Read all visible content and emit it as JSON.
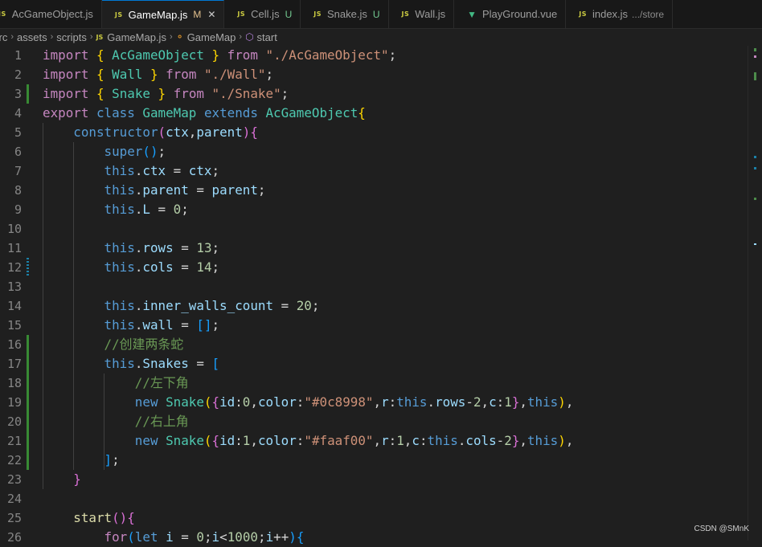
{
  "tabs": [
    {
      "label": "AcGameObject.js",
      "type": "js",
      "active": false,
      "badge": "",
      "hint": ""
    },
    {
      "label": "GameMap.js",
      "type": "js",
      "active": true,
      "badge": "M",
      "hint": ""
    },
    {
      "label": "Cell.js",
      "type": "js",
      "active": false,
      "badge": "U",
      "hint": ""
    },
    {
      "label": "Snake.js",
      "type": "js",
      "active": false,
      "badge": "U",
      "hint": ""
    },
    {
      "label": "Wall.js",
      "type": "js",
      "active": false,
      "badge": "",
      "hint": ""
    },
    {
      "label": "PlayGround.vue",
      "type": "vue",
      "active": false,
      "badge": "",
      "hint": ""
    },
    {
      "label": "index.js",
      "type": "js",
      "active": false,
      "badge": "",
      "hint": ".../store"
    }
  ],
  "js_icon": "JS",
  "close_glyph": "✕",
  "breadcrumb": [
    "src",
    "assets",
    "scripts",
    "GameMap.js",
    "GameMap",
    "start"
  ],
  "watermark": "CSDN @SMnK",
  "colors": {
    "keyword": "#c586c0",
    "storage": "#569cd6",
    "class": "#4ec9b0",
    "string": "#ce9178",
    "number": "#b5cea8",
    "comment": "#6a9955",
    "variable": "#9cdcfe",
    "function": "#dcdcaa",
    "bracket1": "#ffd700",
    "bracket2": "#da70d6",
    "bracket3": "#179fff",
    "default": "#d4d4d4",
    "added": "#388a34",
    "modified": "#1b81a8"
  },
  "lines": [
    {
      "n": "1",
      "t": [
        [
          "import ",
          "k"
        ],
        [
          "{",
          "b1"
        ],
        [
          " AcGameObject ",
          "c"
        ],
        [
          "}",
          "b1"
        ],
        [
          " from ",
          "k"
        ],
        [
          "\"./AcGameObject\"",
          "s"
        ],
        [
          ";",
          "d"
        ]
      ]
    },
    {
      "n": "2",
      "t": [
        [
          "import ",
          "k"
        ],
        [
          "{",
          "b1"
        ],
        [
          " Wall ",
          "c"
        ],
        [
          "}",
          "b1"
        ],
        [
          " from ",
          "k"
        ],
        [
          "\"./Wall\"",
          "s"
        ],
        [
          ";",
          "d"
        ]
      ]
    },
    {
      "n": "3",
      "t": [
        [
          "import ",
          "k"
        ],
        [
          "{",
          "b1"
        ],
        [
          " Snake ",
          "c"
        ],
        [
          "}",
          "b1"
        ],
        [
          " from ",
          "k"
        ],
        [
          "\"./Snake\"",
          "s"
        ],
        [
          ";",
          "d"
        ]
      ]
    },
    {
      "n": "4",
      "t": [
        [
          "export ",
          "k"
        ],
        [
          "class ",
          "st"
        ],
        [
          "GameMap ",
          "c"
        ],
        [
          "extends ",
          "st"
        ],
        [
          "AcGameObject",
          "c"
        ],
        [
          "{",
          "b1"
        ]
      ]
    },
    {
      "n": "5",
      "t": [
        [
          "    constructor",
          "st"
        ],
        [
          "(",
          "b2"
        ],
        [
          "ctx",
          "v"
        ],
        [
          ",",
          "d"
        ],
        [
          "parent",
          "v"
        ],
        [
          ")",
          "b2"
        ],
        [
          "{",
          "b2"
        ]
      ]
    },
    {
      "n": "6",
      "t": [
        [
          "        super",
          "st"
        ],
        [
          "()",
          "b3"
        ],
        [
          ";",
          "d"
        ]
      ]
    },
    {
      "n": "7",
      "t": [
        [
          "        this",
          "st"
        ],
        [
          ".",
          "d"
        ],
        [
          "ctx",
          "v"
        ],
        [
          " = ",
          "d"
        ],
        [
          "ctx",
          "v"
        ],
        [
          ";",
          "d"
        ]
      ]
    },
    {
      "n": "8",
      "t": [
        [
          "        this",
          "st"
        ],
        [
          ".",
          "d"
        ],
        [
          "parent",
          "v"
        ],
        [
          " = ",
          "d"
        ],
        [
          "parent",
          "v"
        ],
        [
          ";",
          "d"
        ]
      ]
    },
    {
      "n": "9",
      "t": [
        [
          "        this",
          "st"
        ],
        [
          ".",
          "d"
        ],
        [
          "L",
          "v"
        ],
        [
          " = ",
          "d"
        ],
        [
          "0",
          "n"
        ],
        [
          ";",
          "d"
        ]
      ]
    },
    {
      "n": "10",
      "t": []
    },
    {
      "n": "11",
      "t": [
        [
          "        this",
          "st"
        ],
        [
          ".",
          "d"
        ],
        [
          "rows",
          "v"
        ],
        [
          " = ",
          "d"
        ],
        [
          "13",
          "n"
        ],
        [
          ";",
          "d"
        ]
      ]
    },
    {
      "n": "12",
      "t": [
        [
          "        this",
          "st"
        ],
        [
          ".",
          "d"
        ],
        [
          "cols",
          "v"
        ],
        [
          " = ",
          "d"
        ],
        [
          "14",
          "n"
        ],
        [
          ";",
          "d"
        ]
      ]
    },
    {
      "n": "13",
      "t": []
    },
    {
      "n": "14",
      "t": [
        [
          "        this",
          "st"
        ],
        [
          ".",
          "d"
        ],
        [
          "inner_walls_count",
          "v"
        ],
        [
          " = ",
          "d"
        ],
        [
          "20",
          "n"
        ],
        [
          ";",
          "d"
        ]
      ]
    },
    {
      "n": "15",
      "t": [
        [
          "        this",
          "st"
        ],
        [
          ".",
          "d"
        ],
        [
          "wall",
          "v"
        ],
        [
          " = ",
          "d"
        ],
        [
          "[]",
          "b3"
        ],
        [
          ";",
          "d"
        ]
      ]
    },
    {
      "n": "16",
      "t": [
        [
          "        //创建两条蛇",
          "cm"
        ]
      ]
    },
    {
      "n": "17",
      "t": [
        [
          "        this",
          "st"
        ],
        [
          ".",
          "d"
        ],
        [
          "Snakes",
          "v"
        ],
        [
          " = ",
          "d"
        ],
        [
          "[",
          "b3"
        ]
      ]
    },
    {
      "n": "18",
      "t": [
        [
          "            //左下角",
          "cm"
        ]
      ]
    },
    {
      "n": "19",
      "t": [
        [
          "            new ",
          "st"
        ],
        [
          "Snake",
          "c"
        ],
        [
          "(",
          "b1"
        ],
        [
          "{",
          "b2"
        ],
        [
          "id",
          "v"
        ],
        [
          ":",
          "d"
        ],
        [
          "0",
          "n"
        ],
        [
          ",",
          "d"
        ],
        [
          "color",
          "v"
        ],
        [
          ":",
          "d"
        ],
        [
          "\"#0c8998\"",
          "s"
        ],
        [
          ",",
          "d"
        ],
        [
          "r",
          "v"
        ],
        [
          ":",
          "d"
        ],
        [
          "this",
          "st"
        ],
        [
          ".",
          "d"
        ],
        [
          "rows",
          "v"
        ],
        [
          "-",
          "d"
        ],
        [
          "2",
          "n"
        ],
        [
          ",",
          "d"
        ],
        [
          "c",
          "v"
        ],
        [
          ":",
          "d"
        ],
        [
          "1",
          "n"
        ],
        [
          "}",
          "b2"
        ],
        [
          ",",
          "d"
        ],
        [
          "this",
          "st"
        ],
        [
          ")",
          "b1"
        ],
        [
          ",",
          "d"
        ]
      ]
    },
    {
      "n": "20",
      "t": [
        [
          "            //右上角",
          "cm"
        ]
      ]
    },
    {
      "n": "21",
      "t": [
        [
          "            new ",
          "st"
        ],
        [
          "Snake",
          "c"
        ],
        [
          "(",
          "b1"
        ],
        [
          "{",
          "b2"
        ],
        [
          "id",
          "v"
        ],
        [
          ":",
          "d"
        ],
        [
          "1",
          "n"
        ],
        [
          ",",
          "d"
        ],
        [
          "color",
          "v"
        ],
        [
          ":",
          "d"
        ],
        [
          "\"#faaf00\"",
          "s"
        ],
        [
          ",",
          "d"
        ],
        [
          "r",
          "v"
        ],
        [
          ":",
          "d"
        ],
        [
          "1",
          "n"
        ],
        [
          ",",
          "d"
        ],
        [
          "c",
          "v"
        ],
        [
          ":",
          "d"
        ],
        [
          "this",
          "st"
        ],
        [
          ".",
          "d"
        ],
        [
          "cols",
          "v"
        ],
        [
          "-",
          "d"
        ],
        [
          "2",
          "n"
        ],
        [
          "}",
          "b2"
        ],
        [
          ",",
          "d"
        ],
        [
          "this",
          "st"
        ],
        [
          ")",
          "b1"
        ],
        [
          ",",
          "d"
        ]
      ]
    },
    {
      "n": "22",
      "t": [
        [
          "        ]",
          "b3"
        ],
        [
          ";",
          "d"
        ]
      ]
    },
    {
      "n": "23",
      "t": [
        [
          "    }",
          "b2"
        ]
      ]
    },
    {
      "n": "24",
      "t": []
    },
    {
      "n": "25",
      "t": [
        [
          "    start",
          "f"
        ],
        [
          "()",
          "b2"
        ],
        [
          "{",
          "b2"
        ]
      ]
    },
    {
      "n": "26",
      "t": [
        [
          "        for",
          "k"
        ],
        [
          "(",
          "b3"
        ],
        [
          "let ",
          "st"
        ],
        [
          "i",
          "v"
        ],
        [
          " = ",
          "d"
        ],
        [
          "0",
          "n"
        ],
        [
          ";",
          "d"
        ],
        [
          "i",
          "v"
        ],
        [
          "<",
          "d"
        ],
        [
          "1000",
          "n"
        ],
        [
          ";",
          "d"
        ],
        [
          "i",
          "v"
        ],
        [
          "++",
          "d"
        ],
        [
          ")",
          "b3"
        ],
        [
          "{",
          "b3"
        ]
      ]
    }
  ],
  "gutter": {
    "3": "added",
    "12": "modified",
    "16": "added",
    "17": "added",
    "18": "added",
    "19": "added",
    "20": "added",
    "21": "added",
    "22": "added"
  }
}
